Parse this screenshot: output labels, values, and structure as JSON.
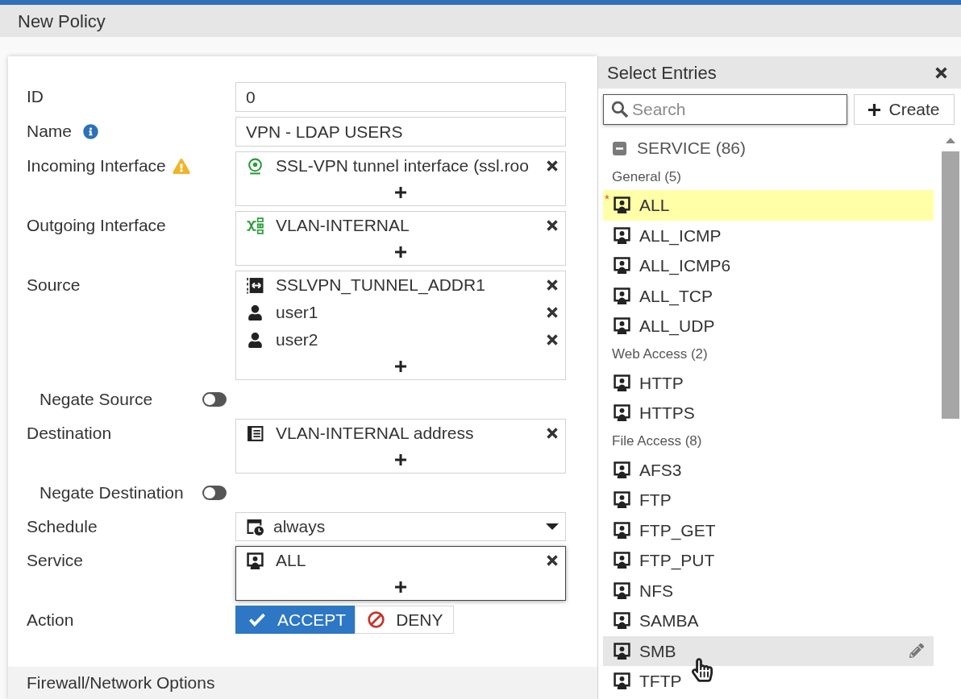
{
  "header": {
    "title": "New Policy"
  },
  "form": {
    "fields": [
      {
        "kind": "text",
        "label": "ID",
        "value": "0"
      },
      {
        "kind": "text",
        "label": "Name",
        "value": "VPN - LDAP USERS",
        "notice": {
          "kind": "info"
        }
      },
      {
        "kind": "multi",
        "label": "Incoming Interface",
        "notice": {
          "kind": "warning"
        },
        "focused": false,
        "entries": [
          {
            "kind": "tunnel-interface",
            "text": "SSL-VPN tunnel interface (ssl.roo"
          }
        ]
      },
      {
        "kind": "multi",
        "label": "Outgoing Interface",
        "focused": false,
        "entries": [
          {
            "kind": "vlan-interface",
            "text": "VLAN-INTERNAL"
          }
        ]
      },
      {
        "kind": "multi",
        "label": "Source",
        "focused": false,
        "entries": [
          {
            "kind": "address-range",
            "text": "SSLVPN_TUNNEL_ADDR1"
          },
          {
            "kind": "user",
            "text": "user1"
          },
          {
            "kind": "user",
            "text": "user2"
          }
        ]
      },
      {
        "kind": "toggle",
        "label": "Negate Source",
        "on": false
      },
      {
        "kind": "multi",
        "label": "Destination",
        "focused": false,
        "entries": [
          {
            "kind": "address",
            "text": "VLAN-INTERNAL address"
          }
        ]
      },
      {
        "kind": "toggle",
        "label": "Negate Destination",
        "on": false
      },
      {
        "kind": "select",
        "label": "Schedule",
        "value": "always"
      },
      {
        "kind": "multi",
        "label": "Service",
        "focused": true,
        "entries": [
          {
            "kind": "service",
            "text": "ALL"
          }
        ]
      },
      {
        "kind": "choice",
        "label": "Action",
        "options": [
          {
            "kind": "accept",
            "label": "ACCEPT",
            "selected": true
          },
          {
            "kind": "deny",
            "label": "DENY",
            "selected": false
          }
        ]
      }
    ]
  },
  "section": {
    "title": "Firewall/Network Options"
  },
  "picker": {
    "title": "Select Entries",
    "search": {
      "placeholder": "Search",
      "focused": true
    },
    "create": "Create",
    "category": {
      "label": "SERVICE (86)",
      "expanded": true
    },
    "groups": [
      {
        "label": "General (5)",
        "items": [
          {
            "label": "ALL",
            "marker": "*",
            "selected": true,
            "hovered": false
          },
          {
            "label": "ALL_ICMP",
            "selected": false,
            "hovered": false
          },
          {
            "label": "ALL_ICMP6",
            "selected": false,
            "hovered": false
          },
          {
            "label": "ALL_TCP",
            "selected": false,
            "hovered": false
          },
          {
            "label": "ALL_UDP",
            "selected": false,
            "hovered": false
          }
        ]
      },
      {
        "label": "Web Access (2)",
        "items": [
          {
            "label": "HTTP",
            "selected": false,
            "hovered": false
          },
          {
            "label": "HTTPS",
            "selected": false,
            "hovered": false
          }
        ]
      },
      {
        "label": "File Access (8)",
        "items": [
          {
            "label": "AFS3",
            "selected": false,
            "hovered": false
          },
          {
            "label": "FTP",
            "selected": false,
            "hovered": false
          },
          {
            "label": "FTP_GET",
            "selected": false,
            "hovered": false
          },
          {
            "label": "FTP_PUT",
            "selected": false,
            "hovered": false
          },
          {
            "label": "NFS",
            "selected": false,
            "hovered": false
          },
          {
            "label": "SAMBA",
            "selected": false,
            "hovered": false
          },
          {
            "label": "SMB",
            "selected": false,
            "hovered": true
          },
          {
            "label": "TFTP",
            "selected": false,
            "hovered": false
          }
        ]
      }
    ]
  }
}
